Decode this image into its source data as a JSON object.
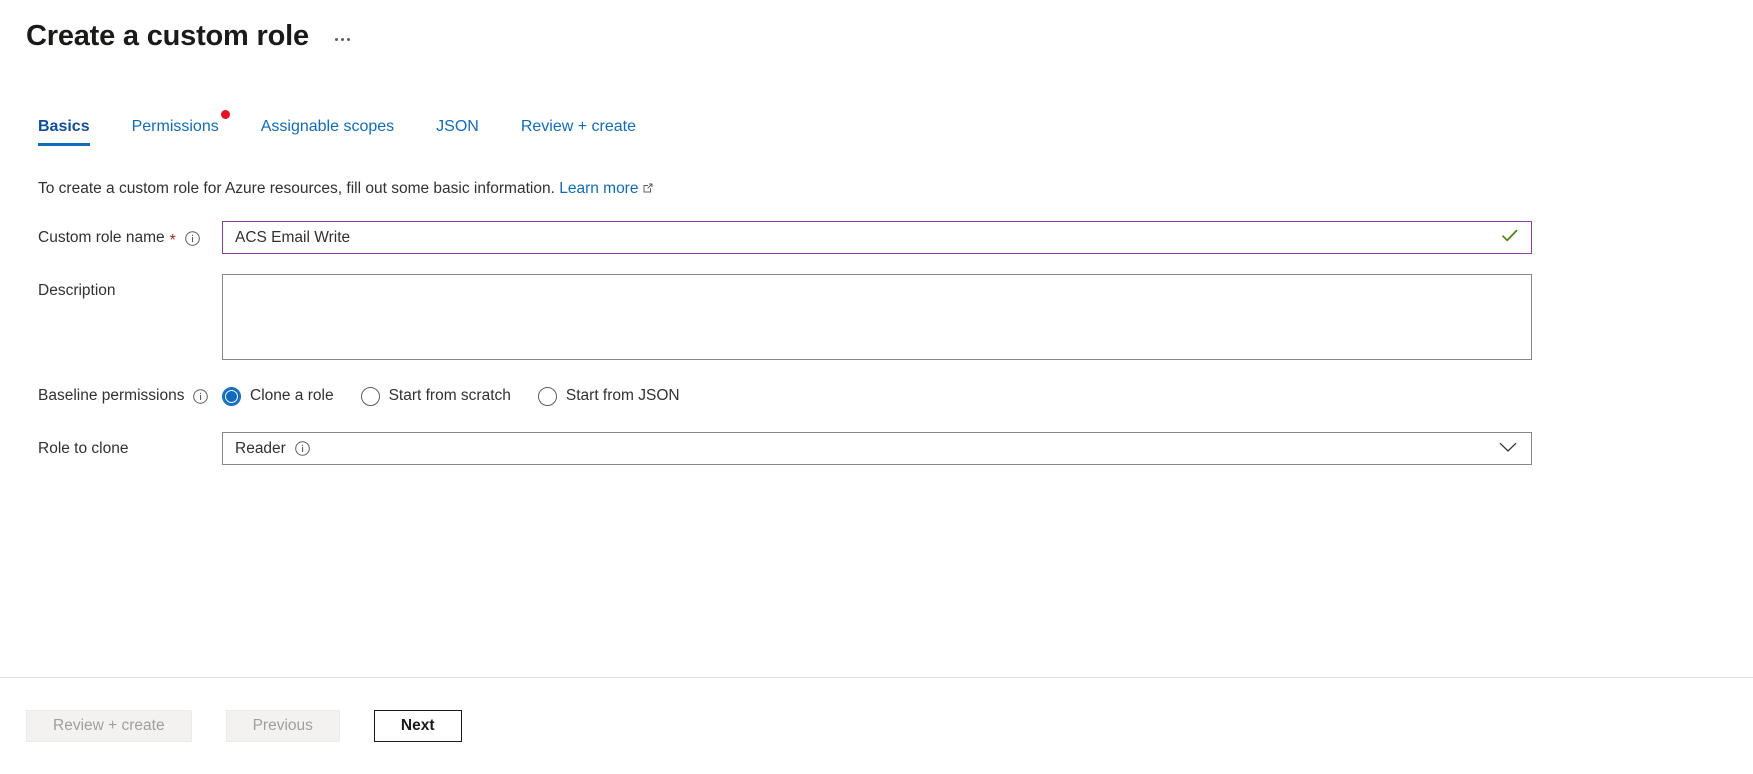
{
  "header": {
    "title": "Create a custom role",
    "more_menu_icon": "ellipsis-icon"
  },
  "tabs": [
    {
      "label": "Basics",
      "active": true,
      "badge": false
    },
    {
      "label": "Permissions",
      "active": false,
      "badge": true
    },
    {
      "label": "Assignable scopes",
      "active": false,
      "badge": false
    },
    {
      "label": "JSON",
      "active": false,
      "badge": false
    },
    {
      "label": "Review + create",
      "active": false,
      "badge": false
    }
  ],
  "intro": {
    "text": "To create a custom role for Azure resources, fill out some basic information.",
    "link_label": "Learn more",
    "link_icon": "external-link-icon"
  },
  "form": {
    "role_name": {
      "label": "Custom role name",
      "required_marker": "*",
      "info_icon": "info-icon",
      "value": "ACS Email Write",
      "placeholder": "",
      "valid_icon": "checkmark-icon"
    },
    "description": {
      "label": "Description",
      "value": "",
      "placeholder": ""
    },
    "baseline_permissions": {
      "label": "Baseline permissions",
      "info_icon": "info-icon",
      "selected": "Clone a role",
      "options": [
        {
          "label": "Clone a role",
          "selected": true
        },
        {
          "label": "Start from scratch",
          "selected": false
        },
        {
          "label": "Start from JSON",
          "selected": false
        }
      ]
    },
    "role_to_clone": {
      "label": "Role to clone",
      "value": "Reader",
      "info_icon": "info-icon",
      "chevron_icon": "chevron-down-icon",
      "options": [
        "Reader"
      ]
    }
  },
  "footer": {
    "review_create_label": "Review + create",
    "previous_label": "Previous",
    "next_label": "Next"
  },
  "colors": {
    "accent_blue": "#0f6cbd",
    "badge_red": "#e81123",
    "input_focus_purple": "#8a3ea0",
    "valid_green": "#498205",
    "required_red": "#a4262c"
  }
}
